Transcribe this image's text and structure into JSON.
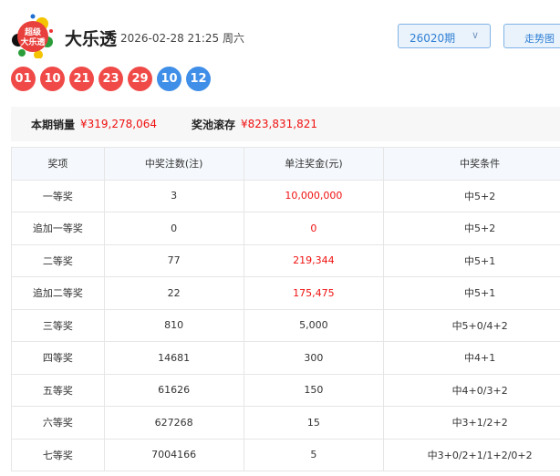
{
  "header": {
    "logo_text": "超级大乐透",
    "title": "大乐透",
    "datetime": "2026-02-28 21:25 周六",
    "issue": "26020期",
    "trend_button": "走势图"
  },
  "balls": {
    "front": [
      "01",
      "10",
      "21",
      "23",
      "29"
    ],
    "back": [
      "10",
      "12"
    ]
  },
  "summary": {
    "sales_label": "本期销量",
    "sales_value": "¥319,278,064",
    "pool_label": "奖池滚存",
    "pool_value": "¥823,831,821"
  },
  "colors": {
    "red_ball": "#f04a48",
    "blue_ball": "#3f8ee8",
    "money": "#f01010"
  },
  "table": {
    "headers": [
      "奖项",
      "中奖注数(注)",
      "单注奖金(元)",
      "中奖条件"
    ],
    "rows": [
      [
        "一等奖",
        "3",
        "10,000,000",
        "中5+2",
        true
      ],
      [
        "追加一等奖",
        "0",
        "0",
        "中5+2",
        true
      ],
      [
        "二等奖",
        "77",
        "219,344",
        "中5+1",
        true
      ],
      [
        "追加二等奖",
        "22",
        "175,475",
        "中5+1",
        true
      ],
      [
        "三等奖",
        "810",
        "5,000",
        "中5+0/4+2",
        false
      ],
      [
        "四等奖",
        "14681",
        "300",
        "中4+1",
        false
      ],
      [
        "五等奖",
        "61626",
        "150",
        "中4+0/3+2",
        false
      ],
      [
        "六等奖",
        "627268",
        "15",
        "中3+1/2+2",
        false
      ],
      [
        "七等奖",
        "7004166",
        "5",
        "中3+0/2+1/1+2/0+2",
        false
      ]
    ]
  }
}
